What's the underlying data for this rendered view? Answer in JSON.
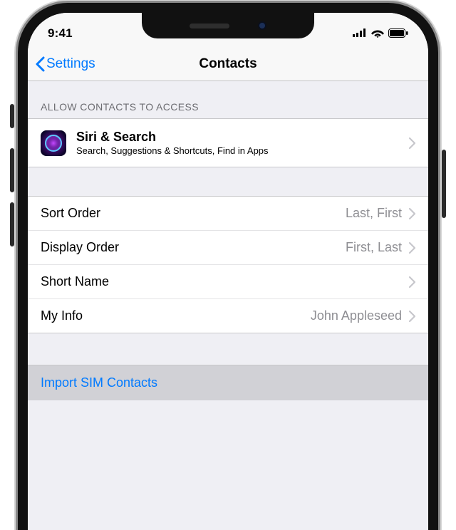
{
  "status": {
    "time": "9:41"
  },
  "nav": {
    "back_label": "Settings",
    "title": "Contacts"
  },
  "sections": {
    "access_header": "ALLOW CONTACTS TO ACCESS",
    "siri": {
      "title": "Siri & Search",
      "subtitle": "Search, Suggestions & Shortcuts, Find in Apps"
    },
    "sort_order": {
      "label": "Sort Order",
      "value": "Last, First"
    },
    "display_order": {
      "label": "Display Order",
      "value": "First, Last"
    },
    "short_name": {
      "label": "Short Name",
      "value": ""
    },
    "my_info": {
      "label": "My Info",
      "value": "John Appleseed"
    },
    "import_sim": {
      "label": "Import SIM Contacts"
    }
  }
}
